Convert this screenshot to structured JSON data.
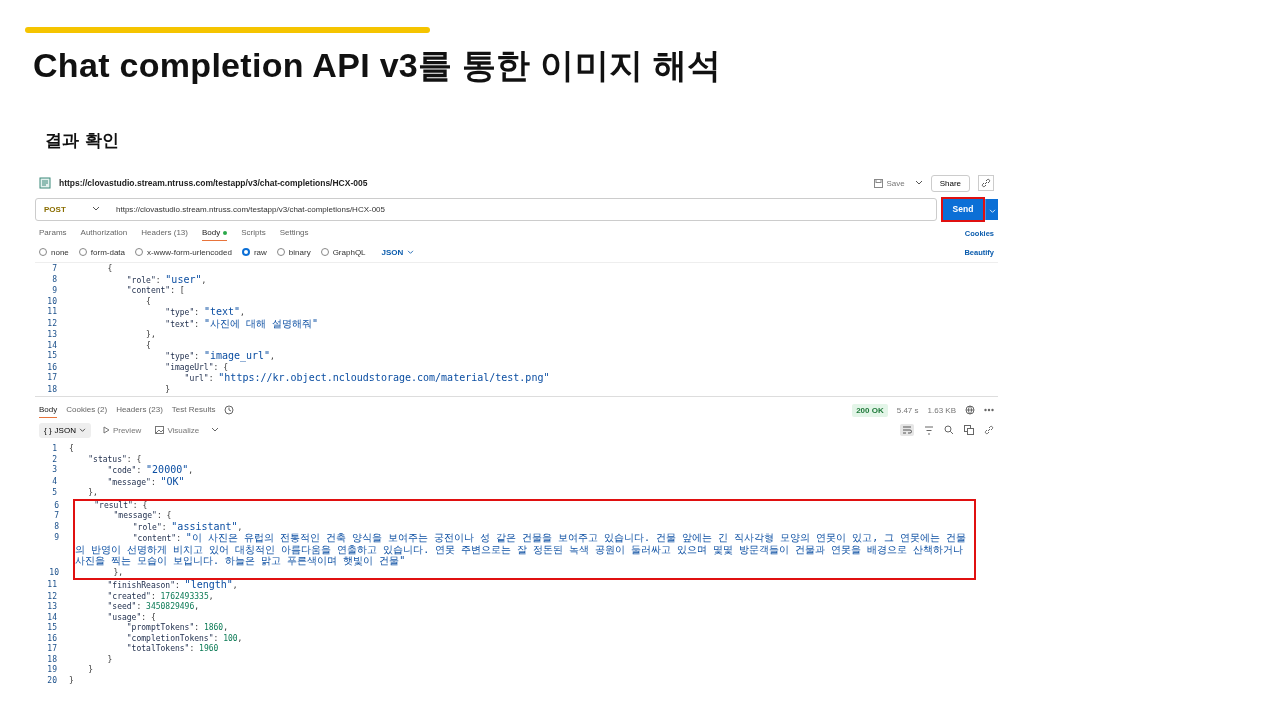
{
  "slide": {
    "title": "Chat completion API v3를 통한 이미지 해석",
    "subtitle": "결과 확인"
  },
  "request": {
    "name": "https://clovastudio.stream.ntruss.com/testapp/v3/chat-completions/HCX-005",
    "save": "Save",
    "share": "Share",
    "method": "POST",
    "url": "https://clovastudio.stream.ntruss.com/testapp/v3/chat-completions/HCX-005",
    "send": {
      "label": "Send",
      "highlighted": true
    },
    "tabs": [
      {
        "label": "Params",
        "selected": false,
        "dot": false
      },
      {
        "label": "Authorization",
        "selected": false,
        "dot": false
      },
      {
        "label": "Headers (13)",
        "selected": false,
        "dot": false
      },
      {
        "label": "Body",
        "selected": true,
        "dot": true
      },
      {
        "label": "Scripts",
        "selected": false,
        "dot": false
      },
      {
        "label": "Settings",
        "selected": false,
        "dot": false
      }
    ],
    "cookies": "Cookies",
    "body_types": [
      {
        "label": "none",
        "selected": false
      },
      {
        "label": "form-data",
        "selected": false
      },
      {
        "label": "x-www-form-urlencoded",
        "selected": false
      },
      {
        "label": "raw",
        "selected": true
      },
      {
        "label": "binary",
        "selected": false
      },
      {
        "label": "GraphQL",
        "selected": false
      }
    ],
    "format": "JSON",
    "beautify": "Beautify",
    "code": [
      {
        "n": "7",
        "text": "        {"
      },
      {
        "n": "8",
        "text": "            \"role\": \"user\","
      },
      {
        "n": "9",
        "text": "            \"content\": ["
      },
      {
        "n": "10",
        "text": "                {"
      },
      {
        "n": "11",
        "text": "                    \"type\": \"text\","
      },
      {
        "n": "12",
        "text": "                    \"text\": \"사진에 대해 설명해줘\""
      },
      {
        "n": "13",
        "text": "                },"
      },
      {
        "n": "14",
        "text": "                {"
      },
      {
        "n": "15",
        "text": "                    \"type\": \"image_url\","
      },
      {
        "n": "16",
        "text": "                    \"imageUrl\": {"
      },
      {
        "n": "17",
        "text": "                        \"url\": \"https://kr.object.ncloudstorage.com/material/test.png\""
      },
      {
        "n": "18",
        "text": "                    }"
      }
    ]
  },
  "response": {
    "tabs": [
      {
        "label": "Body",
        "selected": true
      },
      {
        "label": "Cookies (2)",
        "selected": false
      },
      {
        "label": "Headers (23)",
        "selected": false
      },
      {
        "label": "Test Results",
        "selected": false
      }
    ],
    "status": "200 OK",
    "time": "5.47 s",
    "size": "1.63 KB",
    "format_icon": "{ }",
    "format": "JSON",
    "preview": "Preview",
    "visualize": "Visualize",
    "code": [
      {
        "n": "1",
        "text": "{",
        "highlighted": false
      },
      {
        "n": "2",
        "text": "    \"status\": {",
        "highlighted": false
      },
      {
        "n": "3",
        "text": "        \"code\": \"20000\",",
        "highlighted": false
      },
      {
        "n": "4",
        "text": "        \"message\": \"OK\"",
        "highlighted": false
      },
      {
        "n": "5",
        "text": "    },",
        "highlighted": false
      },
      {
        "n": "6",
        "text": "    \"result\": {",
        "highlighted": true
      },
      {
        "n": "7",
        "text": "        \"message\": {",
        "highlighted": true
      },
      {
        "n": "8",
        "text": "            \"role\": \"assistant\",",
        "highlighted": true
      },
      {
        "n": "9",
        "text": "            \"content\": \"이 사진은 유럽의 전통적인 건축 양식을 보여주는 궁전이나 성 같은 건물을 보여주고 있습니다. 건물 앞에는 긴 직사각형 모양의 연못이 있고, 그 연못에는 건물의 반영이 선명하게 비치고 있어 대칭적인 아름다움을 연출하고 있습니다. 연못 주변으로는 잘 정돈된 녹색 공원이 둘러싸고 있으며 몇몇 방문객들이 건물과 연못을 배경으로 산책하거나 사진을 찍는 모습이 보입니다. 하늘은 맑고 푸른색이며 햇빛이 건물\"",
        "highlighted": true
      },
      {
        "n": "10",
        "text": "        },",
        "highlighted": true
      },
      {
        "n": "11",
        "text": "        \"finishReason\": \"length\",",
        "highlighted": false
      },
      {
        "n": "12",
        "text": "        \"created\": 1762493335,",
        "highlighted": false
      },
      {
        "n": "13",
        "text": "        \"seed\": 3450829496,",
        "highlighted": false
      },
      {
        "n": "14",
        "text": "        \"usage\": {",
        "highlighted": false
      },
      {
        "n": "15",
        "text": "            \"promptTokens\": 1860,",
        "highlighted": false
      },
      {
        "n": "16",
        "text": "            \"completionTokens\": 100,",
        "highlighted": false
      },
      {
        "n": "17",
        "text": "            \"totalTokens\": 1960",
        "highlighted": false
      },
      {
        "n": "18",
        "text": "        }",
        "highlighted": false
      },
      {
        "n": "19",
        "text": "    }",
        "highlighted": false
      },
      {
        "n": "20",
        "text": "}",
        "highlighted": false
      }
    ]
  }
}
